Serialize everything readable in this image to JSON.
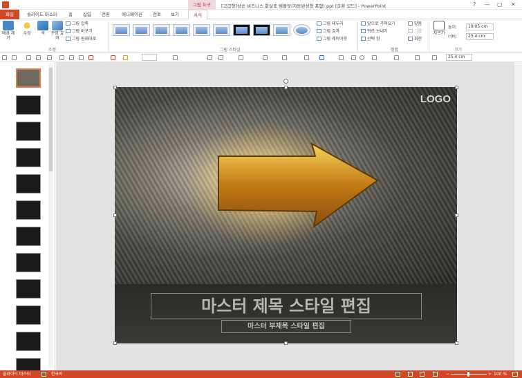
{
  "window": {
    "context_tab": "그림 도구",
    "title": "[고급형]상승 비즈니스 화살표 템플릿(자동완성형 포함).ppt [호환 모드] - PowerPoint",
    "help": "?",
    "min": "—",
    "max": "▢",
    "close": "✕"
  },
  "tabs": [
    "파일",
    "슬라이드 마스터",
    "홈",
    "삽입",
    "전환",
    "애니메이션",
    "검토",
    "보기",
    "서식"
  ],
  "ribbon": {
    "adjust": {
      "remove_bg": "배경 제거",
      "correct": "수정",
      "color": "색",
      "art": "꾸밈 효과",
      "compress": "그림 압축",
      "change": "그림 바꾸기",
      "reset": "그림 원래대로",
      "label": "조정"
    },
    "styles": {
      "label": "그림 스타일",
      "border": "그림 테두리",
      "effects": "그림 효과",
      "layout": "그림 레이아웃"
    },
    "arrange": {
      "bring_forward": "앞으로 가져오기",
      "send_backward": "뒤로 보내기",
      "selection": "선택 창",
      "align": "맞춤",
      "group": "그룹",
      "rotate": "회전",
      "label": "정렬"
    },
    "size": {
      "crop": "자르기",
      "height_label": "높이:",
      "height": "19.05 cm",
      "width_label": "너비:",
      "width": "25.4 cm",
      "label": "크기"
    }
  },
  "qat": {
    "width_field": "25.4 cm"
  },
  "thumbnails": [
    1,
    2,
    3,
    4,
    5,
    6,
    7,
    8,
    9,
    10,
    11,
    12
  ],
  "slide": {
    "logo": "LOGO",
    "title": "마스터 제목 스타일 편집",
    "subtitle": "마스터 부제목 스타일 편집"
  },
  "status": {
    "view": "슬라이드 마스터",
    "language": "한국어",
    "zoom": "100 %"
  }
}
